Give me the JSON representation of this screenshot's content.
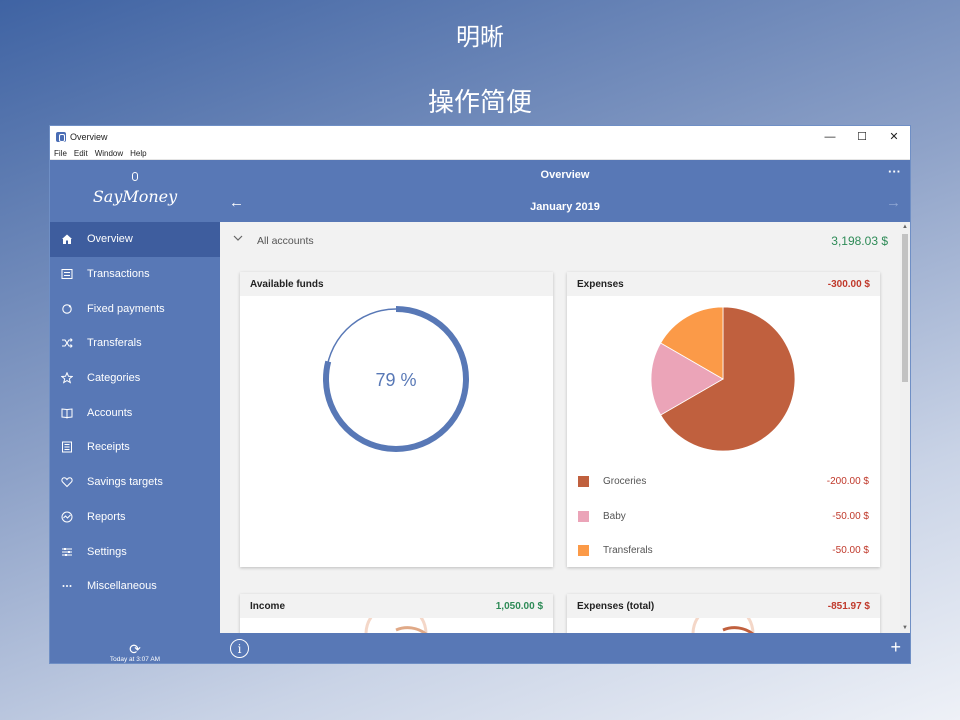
{
  "promo": {
    "line1": "明晰",
    "line2": "操作简便"
  },
  "window": {
    "title": "Overview",
    "controls": {
      "minimize": "—",
      "maximize": "☐",
      "close": "✕"
    },
    "menu": [
      "File",
      "Edit",
      "Window",
      "Help"
    ]
  },
  "sidebar": {
    "logo": "SayMoney",
    "items": [
      {
        "label": "Overview",
        "icon": "home-icon",
        "active": true
      },
      {
        "label": "Transactions",
        "icon": "list-icon"
      },
      {
        "label": "Fixed payments",
        "icon": "refresh-icon"
      },
      {
        "label": "Transferals",
        "icon": "shuffle-icon"
      },
      {
        "label": "Categories",
        "icon": "star-icon"
      },
      {
        "label": "Accounts",
        "icon": "book-icon"
      },
      {
        "label": "Receipts",
        "icon": "receipt-icon"
      },
      {
        "label": "Savings targets",
        "icon": "heart-icon"
      },
      {
        "label": "Reports",
        "icon": "chart-icon"
      },
      {
        "label": "Settings",
        "icon": "sliders-icon"
      },
      {
        "label": "Miscellaneous",
        "icon": "more-icon"
      }
    ],
    "sync_text": "Today at 3:07 AM"
  },
  "header": {
    "title": "Overview",
    "month": "January 2019",
    "more": "···",
    "prev": "←",
    "next": "→"
  },
  "accounts": {
    "label": "All accounts",
    "total": "3,198.03 $"
  },
  "cards": {
    "available": {
      "title": "Available funds",
      "percent_text": "79 %",
      "percent": 79
    },
    "expenses": {
      "title": "Expenses",
      "amount": "-300.00 $",
      "legend": [
        {
          "name": "Groceries",
          "value": "-200.00 $",
          "amount": 200,
          "color": "#c0603e"
        },
        {
          "name": "Baby",
          "value": "-50.00 $",
          "amount": 50,
          "color": "#eba4b8"
        },
        {
          "name": "Transferals",
          "value": "-50.00 $",
          "amount": 50,
          "color": "#fb9a48"
        }
      ]
    },
    "income": {
      "title": "Income",
      "amount": "1,050.00 $"
    },
    "expenses_total": {
      "title": "Expenses (total)",
      "amount": "-851.97 $"
    }
  },
  "footer": {
    "info": "i",
    "add": "+"
  },
  "colors": {
    "accent": "#5878b6",
    "active_nav": "#3e5d9e",
    "positive": "#2e8b57",
    "negative": "#c0392b"
  }
}
